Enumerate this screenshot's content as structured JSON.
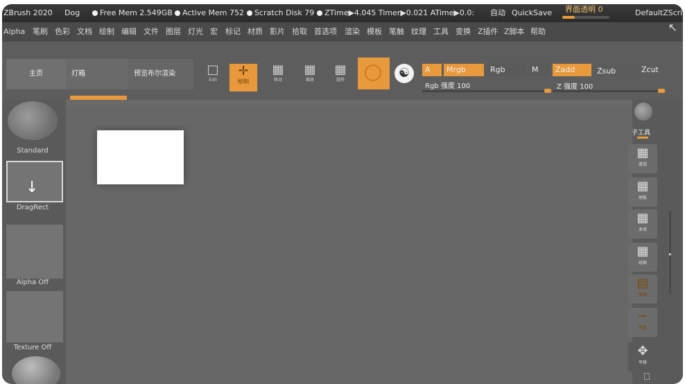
{
  "titlebar": {
    "app": "ZBrush 2020",
    "doc": "Dog",
    "free_mem": "Free Mem 2.549GB",
    "active_mem": "Active Mem 752",
    "scratch": "Scratch Disk 79",
    "ztime": "ZTime▶4.045 Timer▶0.021 ATime▶0.0:",
    "auto": "自动",
    "quicksave": "QuickSave",
    "opacity": "界面透明 0",
    "script": "DefaultZScript"
  },
  "menu": [
    "Alpha",
    "笔刷",
    "色彩",
    "文档",
    "绘制",
    "编辑",
    "文件",
    "图层",
    "灯光",
    "宏",
    "标记",
    "材质",
    "影片",
    "拾取",
    "首选项",
    "渲染",
    "模板",
    "笔触",
    "纹理",
    "工具",
    "变换",
    "Z插件",
    "Z脚本",
    "帮助"
  ],
  "toolbar": {
    "home": "主页",
    "lightbox": "灯箱",
    "bpr": "预览布尔渲染",
    "edit_sub": "Edit",
    "draw_label": "绘制",
    "move_sub": "移动",
    "scale_sub": "缩放",
    "rotate_sub": "旋转",
    "a": "A",
    "mrgb": "Mrgb",
    "rgb": "Rgb",
    "m": "M",
    "zadd": "Zadd",
    "zsub": "Zsub",
    "zcut": "Zcut",
    "rgb_intensity": "Rgb 强度 100",
    "z_intensity": "Z 强度 100"
  },
  "left_tray": {
    "brush": "Standard",
    "stroke": "DragRect",
    "alpha": "Alpha Off",
    "texture": "Texture Off"
  },
  "right_shelf": {
    "subtool": "子工具",
    "b1": "透视",
    "b2": "地板",
    "b3": "本地",
    "b4": "线框",
    "b5": "编辑",
    "b6": "参数",
    "b7": "平移"
  },
  "colors": {
    "accent": "#e8993b",
    "background": "#676767"
  }
}
